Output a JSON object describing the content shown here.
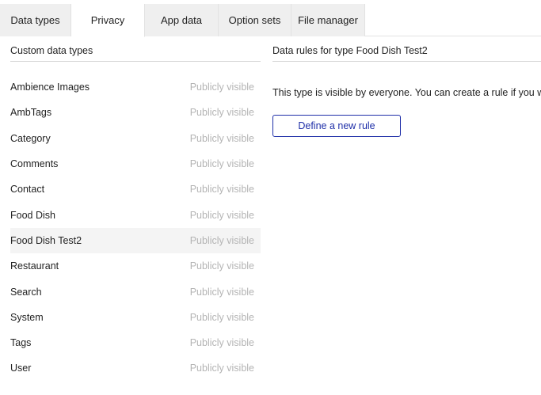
{
  "tabs": [
    {
      "label": "Data types",
      "active": false
    },
    {
      "label": "Privacy",
      "active": true
    },
    {
      "label": "App data",
      "active": false
    },
    {
      "label": "Option sets",
      "active": false
    },
    {
      "label": "File manager",
      "active": false
    }
  ],
  "left": {
    "title": "Custom data types",
    "items": [
      {
        "name": "Ambience Images",
        "visibility": "Publicly visible",
        "selected": false
      },
      {
        "name": "AmbTags",
        "visibility": "Publicly visible",
        "selected": false
      },
      {
        "name": "Category",
        "visibility": "Publicly visible",
        "selected": false
      },
      {
        "name": "Comments",
        "visibility": "Publicly visible",
        "selected": false
      },
      {
        "name": "Contact",
        "visibility": "Publicly visible",
        "selected": false
      },
      {
        "name": "Food Dish",
        "visibility": "Publicly visible",
        "selected": false
      },
      {
        "name": "Food Dish Test2",
        "visibility": "Publicly visible",
        "selected": true
      },
      {
        "name": "Restaurant",
        "visibility": "Publicly visible",
        "selected": false
      },
      {
        "name": "Search",
        "visibility": "Publicly visible",
        "selected": false
      },
      {
        "name": "System",
        "visibility": "Publicly visible",
        "selected": false
      },
      {
        "name": "Tags",
        "visibility": "Publicly visible",
        "selected": false
      },
      {
        "name": "User",
        "visibility": "Publicly visible",
        "selected": false
      }
    ]
  },
  "right": {
    "title": "Data rules for type Food Dish Test2",
    "description": "This type is visible by everyone. You can create a rule if you want",
    "define_button": "Define a new rule"
  },
  "colors": {
    "accent": "#1f2fa8",
    "muted": "#b4b4b4",
    "selected_row": "#f4f4f4",
    "tab_inactive": "#efefef"
  }
}
